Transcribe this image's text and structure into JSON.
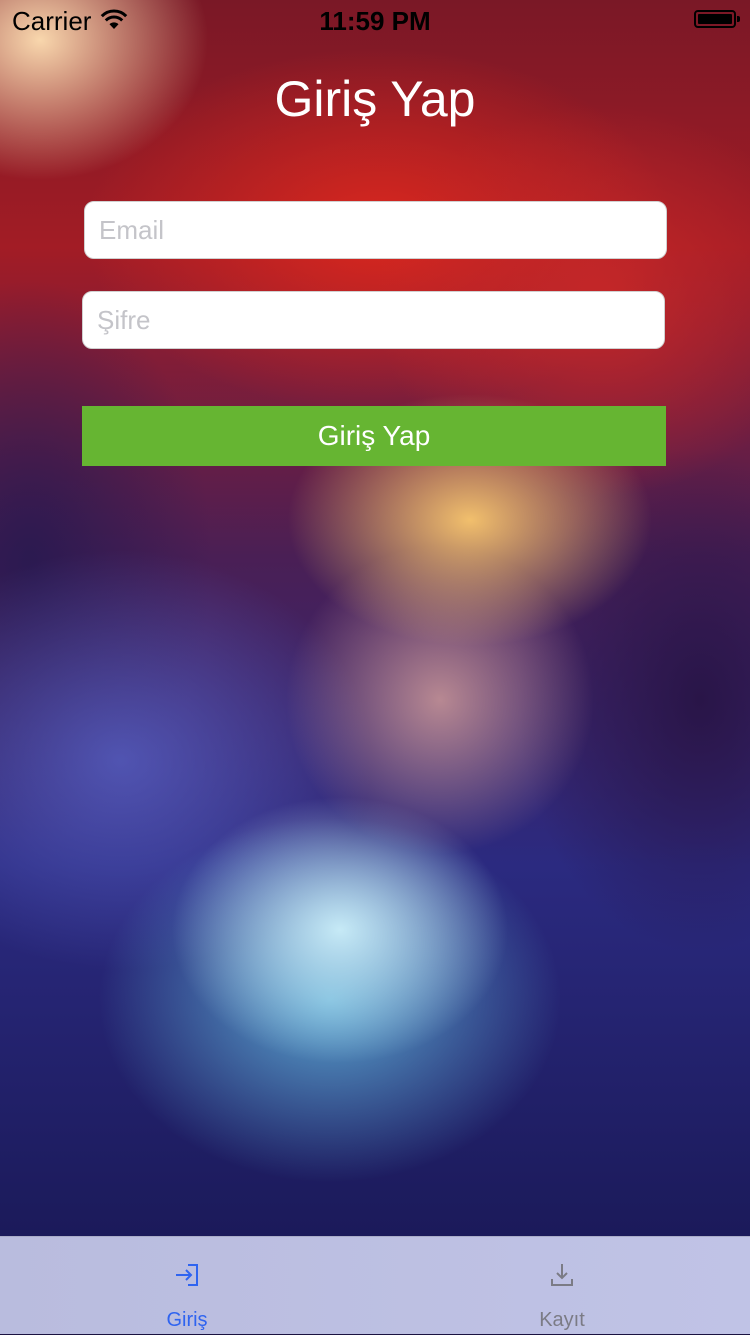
{
  "status_bar": {
    "carrier": "Carrier",
    "time": "11:59 PM",
    "icons": [
      "wifi-icon",
      "battery-icon"
    ]
  },
  "login": {
    "title": "Giriş Yap",
    "email_placeholder": "Email",
    "password_placeholder": "Şifre",
    "submit_label": "Giriş Yap",
    "submit_color": "#66b532"
  },
  "tab_bar": {
    "items": [
      {
        "label": "Giriş",
        "icon": "sign-in-icon",
        "active": true,
        "color": "#2f64f0"
      },
      {
        "label": "Kayıt",
        "icon": "download-icon",
        "active": false,
        "color": "#7b7b85"
      }
    ]
  }
}
